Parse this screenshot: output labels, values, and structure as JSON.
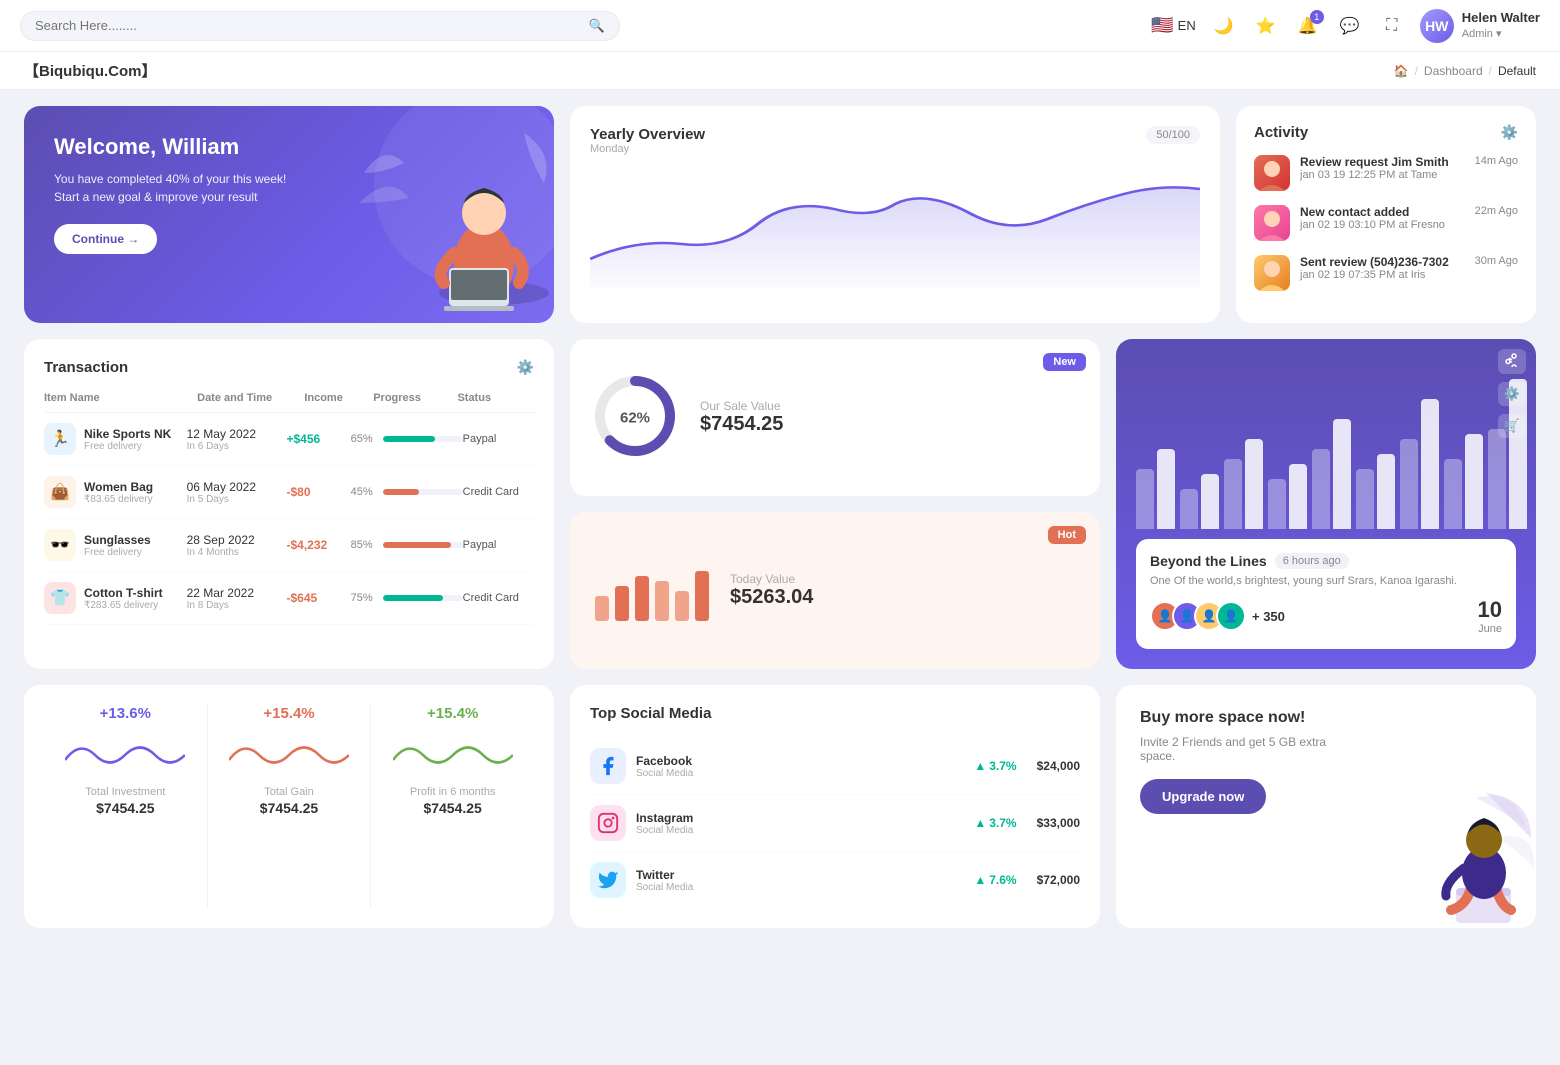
{
  "topnav": {
    "search_placeholder": "Search Here........",
    "lang": "EN",
    "notification_count": "1",
    "user": {
      "name": "Helen Walter",
      "role": "Admin"
    }
  },
  "breadcrumb": {
    "brand": "【Biqubiqu.Com】",
    "items": [
      "Home",
      "Dashboard",
      "Default"
    ]
  },
  "welcome": {
    "title": "Welcome, William",
    "subtitle": "You have completed 40% of your this week! Start a new goal & improve your result",
    "button": "Continue →"
  },
  "yearly": {
    "title": "Yearly Overview",
    "day": "Monday",
    "badge": "50/100"
  },
  "activity": {
    "title": "Activity",
    "items": [
      {
        "name": "Review request Jim Smith",
        "desc": "jan 03 19 12:25 PM at Tame",
        "time": "14m Ago",
        "color": "#e17055"
      },
      {
        "name": "New contact added",
        "desc": "jan 02 19 03:10 PM at Fresno",
        "time": "22m Ago",
        "color": "#fd79a8"
      },
      {
        "name": "Sent review (504)236-7302",
        "desc": "jan 02 19 07:35 PM at Iris",
        "time": "30m Ago",
        "color": "#fdcb6e"
      }
    ]
  },
  "transaction": {
    "title": "Transaction",
    "columns": [
      "Item Name",
      "Date and Time",
      "Income",
      "Progress",
      "Status"
    ],
    "rows": [
      {
        "icon": "🏃",
        "icon_bg": "#e8f4fd",
        "name": "Nike Sports NK",
        "sub": "Free delivery",
        "date": "12 May 2022",
        "days": "In 6 Days",
        "income": "+$456",
        "income_type": "pos",
        "progress": 65,
        "progress_color": "#00b894",
        "status": "Paypal"
      },
      {
        "icon": "👜",
        "icon_bg": "#fdf3e8",
        "name": "Women Bag",
        "sub": "₹83.65 delivery",
        "date": "06 May 2022",
        "days": "In 5 Days",
        "income": "-$80",
        "income_type": "neg",
        "progress": 45,
        "progress_color": "#e17055",
        "status": "Credit Card"
      },
      {
        "icon": "🕶️",
        "icon_bg": "#fef9e7",
        "name": "Sunglasses",
        "sub": "Free delivery",
        "date": "28 Sep 2022",
        "days": "In 4 Months",
        "income": "-$4,232",
        "income_type": "neg",
        "progress": 85,
        "progress_color": "#e17055",
        "status": "Paypal"
      },
      {
        "icon": "👕",
        "icon_bg": "#fce4e4",
        "name": "Cotton T-shirt",
        "sub": "₹283.65 delivery",
        "date": "22 Mar 2022",
        "days": "In 8 Days",
        "income": "-$645",
        "income_type": "neg",
        "progress": 75,
        "progress_color": "#00b894",
        "status": "Credit Card"
      }
    ]
  },
  "salevalue": {
    "badge": "New",
    "label": "Our Sale Value",
    "value": "$7454.25",
    "percent": "62%"
  },
  "todayvalue": {
    "badge": "Hot",
    "label": "Today Value",
    "value": "$5263.04"
  },
  "beyond": {
    "title": "Beyond the Lines",
    "time": "6 hours ago",
    "desc": "One Of the world,s brightest, young surf Srars, Kanoa Igarashi.",
    "plus_count": "+ 350",
    "date_num": "10",
    "date_month": "June"
  },
  "stats": [
    {
      "pct": "+13.6%",
      "color": "purple",
      "label": "Total Investment",
      "value": "$7454.25"
    },
    {
      "pct": "+15.4%",
      "color": "orange",
      "label": "Total Gain",
      "value": "$7454.25"
    },
    {
      "pct": "+15.4%",
      "color": "lime",
      "label": "Profit in 6 months",
      "value": "$7454.25"
    }
  ],
  "social": {
    "title": "Top Social Media",
    "items": [
      {
        "icon": "f",
        "icon_color": "#1877F2",
        "name": "Facebook",
        "sub": "Social Media",
        "pct": "3.7%",
        "amount": "$24,000"
      },
      {
        "icon": "📷",
        "icon_color": "#e1306c",
        "name": "Instagram",
        "sub": "Social Media",
        "pct": "3.7%",
        "amount": "$33,000"
      },
      {
        "icon": "🐦",
        "icon_color": "#1da1f2",
        "name": "Twitter",
        "sub": "Social Media",
        "pct": "7.6%",
        "amount": "$72,000"
      }
    ]
  },
  "buyspace": {
    "title": "Buy more space now!",
    "desc": "Invite 2 Friends and get 5 GB extra space.",
    "button": "Upgrade now"
  }
}
